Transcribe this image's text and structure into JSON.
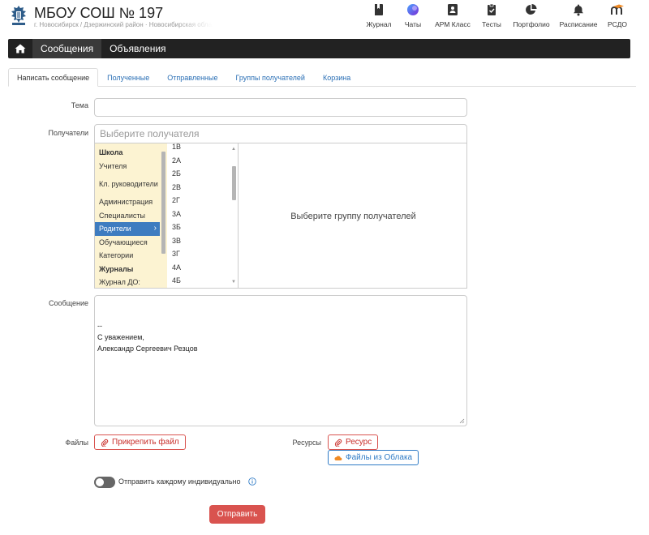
{
  "header": {
    "title": "МБОУ СОШ № 197",
    "subtitle": "г. Новосибирск / Дзержинский район · Новосибирская облас",
    "logo_icon": "coat-of-arms-icon"
  },
  "top_nav": [
    {
      "label": "Журнал",
      "icon": "journal-icon"
    },
    {
      "label": "Чаты",
      "icon": "chats-icon"
    },
    {
      "label": "АРМ Класс",
      "icon": "arm-class-icon"
    },
    {
      "label": "Тесты",
      "icon": "tests-icon"
    },
    {
      "label": "Портфолио",
      "icon": "portfolio-icon"
    },
    {
      "label": "Расписание",
      "icon": "schedule-bell-icon"
    },
    {
      "label": "РСДО",
      "icon": "rsdo-icon"
    }
  ],
  "navbar": {
    "home_icon": "home-icon",
    "links": [
      "Сообщения",
      "Объявления"
    ]
  },
  "tabs": [
    "Написать сообщение",
    "Полученные",
    "Отправленные",
    "Группы получателей",
    "Корзина"
  ],
  "form": {
    "subject_label": "Тема",
    "subject_value": "",
    "recipients_label": "Получатели",
    "recipients_placeholder": "Выберите получателя",
    "message_label": "Сообщение",
    "message_lines": [
      "",
      "--",
      "С уважением,",
      "Александр Сергеевич Резцов"
    ],
    "files_label": "Файлы",
    "attach_button": "Прикрепить файл",
    "resources_label": "Ресурсы",
    "resource_button": "Ресурс",
    "cloud_button": "Файлы из Облака",
    "individual_toggle_label": "Отправить каждому индивидуально",
    "individual_toggle_on": false,
    "send_button": "Отправить"
  },
  "picker": {
    "categories": [
      {
        "label": "Школа",
        "bold": true
      },
      {
        "label": "Учителя",
        "bold": false
      },
      {
        "label": "Кл. руководители",
        "bold": false
      },
      {
        "label": "Администрация",
        "bold": false
      },
      {
        "label": "Специалисты",
        "bold": false
      },
      {
        "label": "Родители",
        "bold": false,
        "selected": true
      },
      {
        "label": "Обучающиеся",
        "bold": false
      },
      {
        "label": "Категории",
        "bold": false
      },
      {
        "label": "Журналы",
        "bold": true
      },
      {
        "label": "Журнал ДО:",
        "bold": false
      }
    ],
    "classes": [
      "1В",
      "2А",
      "2Б",
      "2В",
      "2Г",
      "3А",
      "3Б",
      "3В",
      "3Г",
      "4А",
      "4Б"
    ],
    "placeholder": "Выберите группу получателей"
  },
  "colors": {
    "navbar": "#222222",
    "accent_blue": "#3e7cc0",
    "danger": "#d9534f",
    "picker_bg": "#fcf3d2"
  }
}
